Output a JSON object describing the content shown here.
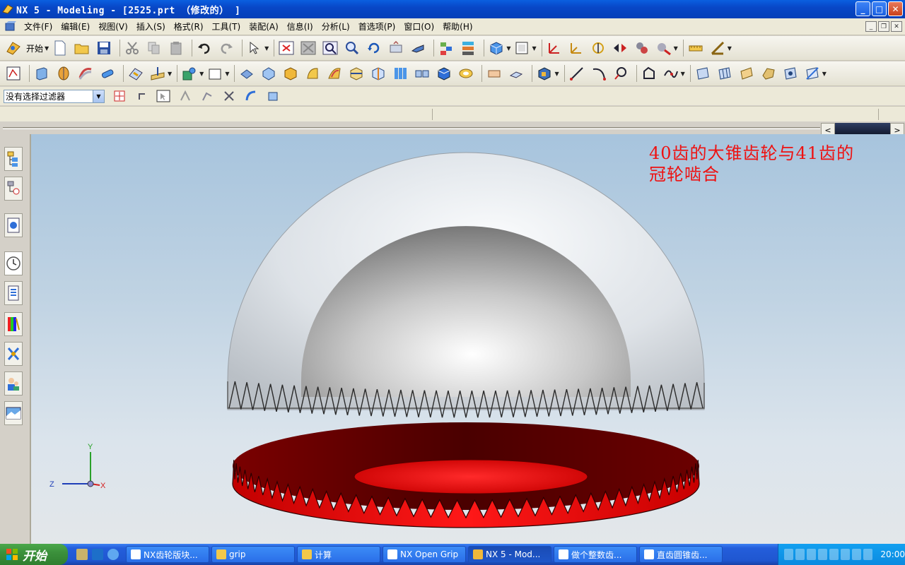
{
  "window": {
    "title": "NX 5 - Modeling - [2525.prt （修改的） ]",
    "buttons": {
      "minimize": "_",
      "maximize": "□",
      "close": "✕"
    }
  },
  "menu": {
    "items": [
      "文件(F)",
      "编辑(E)",
      "视图(V)",
      "插入(S)",
      "格式(R)",
      "工具(T)",
      "装配(A)",
      "信息(I)",
      "分析(L)",
      "首选项(P)",
      "窗口(O)",
      "帮助(H)"
    ]
  },
  "toolbar": {
    "start_label": "开始"
  },
  "selection": {
    "filter_value": "没有选择过滤器"
  },
  "viewport": {
    "annotation_line1": "40齿的大锥齿轮与41齿的",
    "annotation_line2": "冠轮啮合",
    "triad": {
      "y": "Y",
      "z": "Z",
      "x": "X"
    },
    "colors": {
      "gear": "#ee1111",
      "gear_dark": "#6b0000",
      "annotation": "#ee1111"
    }
  },
  "taskbar": {
    "start_label": "开始",
    "tasks": [
      "NX齿轮版块...",
      "grip",
      "计算",
      "NX Open Grip",
      "NX 5 - Mod...",
      "做个整数齿...",
      "直齿圆锥齿..."
    ],
    "clock": "20:00"
  }
}
